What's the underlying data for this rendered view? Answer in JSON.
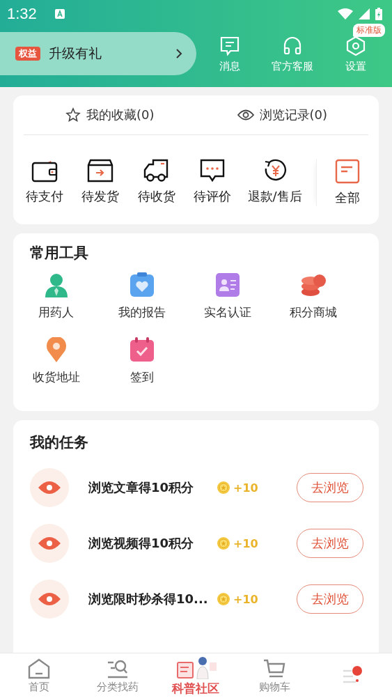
{
  "status_bar": {
    "time": "1:32"
  },
  "header": {
    "promo": {
      "badge": "权益",
      "label": "升级有礼"
    },
    "actions": [
      {
        "kind": "message",
        "label": "消息"
      },
      {
        "kind": "service",
        "label": "官方客服"
      },
      {
        "kind": "settings",
        "label": "设置",
        "badge": "标准版"
      }
    ]
  },
  "quick_links": [
    {
      "kind": "star",
      "label": "我的收藏(0)"
    },
    {
      "kind": "eye",
      "label": "浏览记录(0)"
    }
  ],
  "orders": [
    {
      "kind": "wallet",
      "label": "待支付"
    },
    {
      "kind": "box",
      "label": "待发货"
    },
    {
      "kind": "truck",
      "label": "待收货"
    },
    {
      "kind": "chat",
      "label": "待评价"
    },
    {
      "kind": "refund",
      "label": "退款/售后"
    },
    {
      "kind": "all",
      "label": "全部"
    }
  ],
  "tools": {
    "title": "常用工具",
    "items": [
      {
        "kind": "person",
        "label": "用药人"
      },
      {
        "kind": "report",
        "label": "我的报告"
      },
      {
        "kind": "id",
        "label": "实名认证"
      },
      {
        "kind": "coins",
        "label": "积分商城"
      },
      {
        "kind": "pin",
        "label": "收货地址"
      },
      {
        "kind": "calendar",
        "label": "签到"
      }
    ]
  },
  "tasks": {
    "title": "我的任务",
    "items": [
      {
        "label": "浏览文章得10积分",
        "points": "+10",
        "button": "去浏览"
      },
      {
        "label": "浏览视频得10积分",
        "points": "+10",
        "button": "去浏览"
      },
      {
        "label": "浏览限时秒杀得10...",
        "points": "+10",
        "button": "去浏览"
      }
    ]
  },
  "nav": [
    {
      "kind": "home",
      "label": "首页"
    },
    {
      "kind": "search",
      "label": "分类找药"
    },
    {
      "kind": "community",
      "label": "科普社区"
    },
    {
      "kind": "cart",
      "label": "购物车"
    },
    {
      "kind": "me"
    }
  ]
}
